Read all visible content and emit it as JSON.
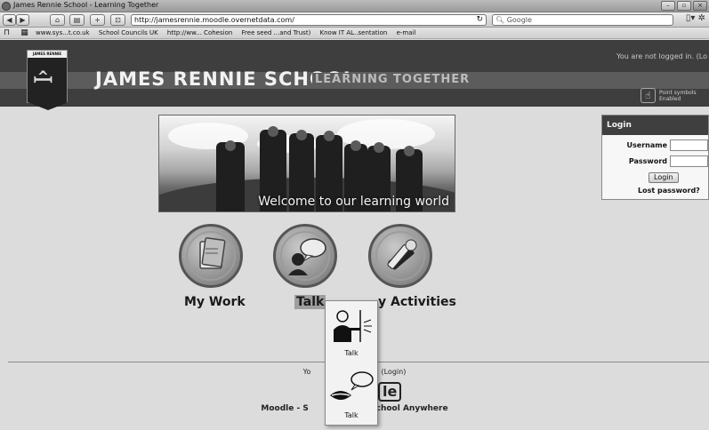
{
  "browser": {
    "window_title": "James Rennie School - Learning Together",
    "url": "http://jamesrennie.moodle.overnetdata.com/",
    "search_placeholder": "Google",
    "bookmarks": [
      "www.sys...t.co.uk",
      "School Councils UK",
      "http://ww... Cohesion",
      "Free seed ...and Trust)",
      "Know IT AL..sentation",
      "e-mail"
    ]
  },
  "header": {
    "logo_text": "JAMES RENNIE",
    "school_name": "JAMES RENNIE SCHOOL",
    "tagline": "LEARNING TOGETHER",
    "login_status": "You are not logged in. (Lo",
    "point_symbols_label_1": "Point symbols",
    "point_symbols_label_2": "Enabled"
  },
  "banner": {
    "caption": "Welcome to our learning world"
  },
  "nav": {
    "items": [
      {
        "label": "My Work",
        "icon": "folder-icon"
      },
      {
        "label": "Talk",
        "icon": "speech-bubble-icon"
      },
      {
        "label": "y Activities",
        "icon": "tools-icon"
      }
    ]
  },
  "login": {
    "heading": "Login",
    "username_label": "Username",
    "password_label": "Password",
    "login_button": "Login",
    "lost_password": "Lost password?"
  },
  "footer": {
    "login_left": "Yo",
    "login_right": "d in. (Login)",
    "moodle_logo_tail": "le",
    "moodle_left": "Moodle - S",
    "moodle_right": "y School Anywhere"
  },
  "popup": {
    "items": [
      {
        "label": "Talk",
        "icon": "person-speaking-icon"
      },
      {
        "label": "Talk",
        "icon": "mouth-speech-icon"
      }
    ]
  }
}
